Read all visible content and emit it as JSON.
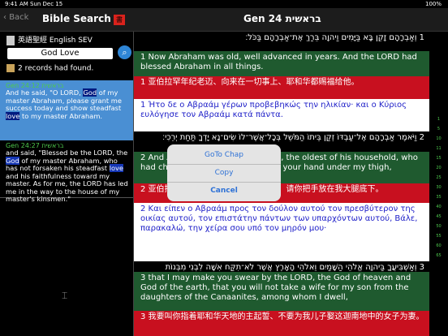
{
  "status": {
    "time": "9:41 AM   Sun Dec 15",
    "battery": "100%"
  },
  "nav": {
    "back": "Back",
    "left_title": "Bible Search",
    "icon_char": "書",
    "chapter_title": "Gen 24 בראשית"
  },
  "sidebar": {
    "version_label": "英語聖經 English SEV",
    "search_value": "God Love",
    "records": "2 records had found.",
    "results": [
      {
        "ref": "Gen 24:12 בראשית",
        "segments": [
          "And he said, \"O LORD, ",
          "God",
          " of my master Abraham, please grant me success today and show steadfast ",
          "love",
          " to my master Abraham."
        ]
      },
      {
        "ref": "Gen 24:27 בראשית",
        "segments": [
          "and said, \"Blessed be the LORD, the ",
          "God",
          " of my master Abraham, who has not forsaken his steadfast ",
          "love",
          " and his faithfulness toward my master. As for me, the LORD has led me in the way to the house of my master's kinsmen.\""
        ]
      }
    ]
  },
  "verses": [
    {
      "style": "black heb",
      "text": "1 וְאַבְרָהָם זָקֵן בָּא בַּיָּמִים וַיהוָה בֵּרַךְ אֶת־אַבְרָהָם בַּכֹּל׃"
    },
    {
      "style": "green",
      "text": "1 Now Abraham was old, well advanced in years. And the LORD had blessed Abraham in all things."
    },
    {
      "style": "red",
      "text": "1 亚伯拉罕年纪老迈、向来在一切事上、耶和华都赐福给他。"
    },
    {
      "style": "white",
      "text": "1 Ήτο δε ο Αβραάμ γέρων προβεβηκώς την ηλικίαν· και ο Κύριος ευλόγησε τον Αβραάμ κατά πάντα."
    },
    {
      "style": "black heb",
      "text": "2 וַיֹּאמֶר אַבְרָהָם אֶל־עַבְדּוֹ זְקַן בֵּיתוֹ הַמֹּשֵׁל בְּכָל־אֲשֶׁר־לוֹ שִׂים־נָא יָדְךָ תַּחַת יְרֵכִי׃"
    },
    {
      "style": "green",
      "text": "2 And Abraham said to his servant, the oldest of his household, who had charge of all that he had, \"Put your hand under my thigh,"
    },
    {
      "style": "red",
      "text": "2 亚伯拉罕对管理他全业最老的仆人说、请你把手放在我大腿底下。"
    },
    {
      "style": "white",
      "text": "2 Και είπεν ο Αβραάμ προς τον δούλον αυτού τον πρεσβύτερον της οικίας αυτού, τον επιστάτην πάντων των υπαρχόντων αυτού, Βάλε, παρακαλώ, την χείρα σου υπό τον μηρόν μου·"
    },
    {
      "style": "black heb",
      "text": "3 וְאַשְׁבִּיעֲךָ בַּיהוָה אֱלֹהֵי הַשָּׁמַיִם וֵאלֹהֵי הָאָרֶץ אֲשֶׁר לֹא־תִקַּח אִשָּׁה לִבְנִי מִבְּנוֹת הַכְּנַעֲנִי אֲשֶׁר אָנֹכִי יוֹשֵׁב בְּקִרְבּוֹ׃"
    },
    {
      "style": "green",
      "text": "3 that I may make you swear by the LORD, the God of heaven and God of the earth, that you will not take a wife for my son from the daughters of the Canaanites, among whom I dwell,"
    },
    {
      "style": "red",
      "text": "3 我要叫你指着耶和华天地的主起誓、不要为我儿子娶这迦南地中的女子为妻。"
    }
  ],
  "gutter_numbers": [
    "1",
    "5",
    "10",
    "11",
    "15",
    "20",
    "25",
    "30",
    "35",
    "40",
    "45",
    "50",
    "55",
    "60",
    "65"
  ],
  "popup": {
    "goto": "GoTo Chap",
    "copy": "Copy",
    "cancel": "Cancel"
  }
}
